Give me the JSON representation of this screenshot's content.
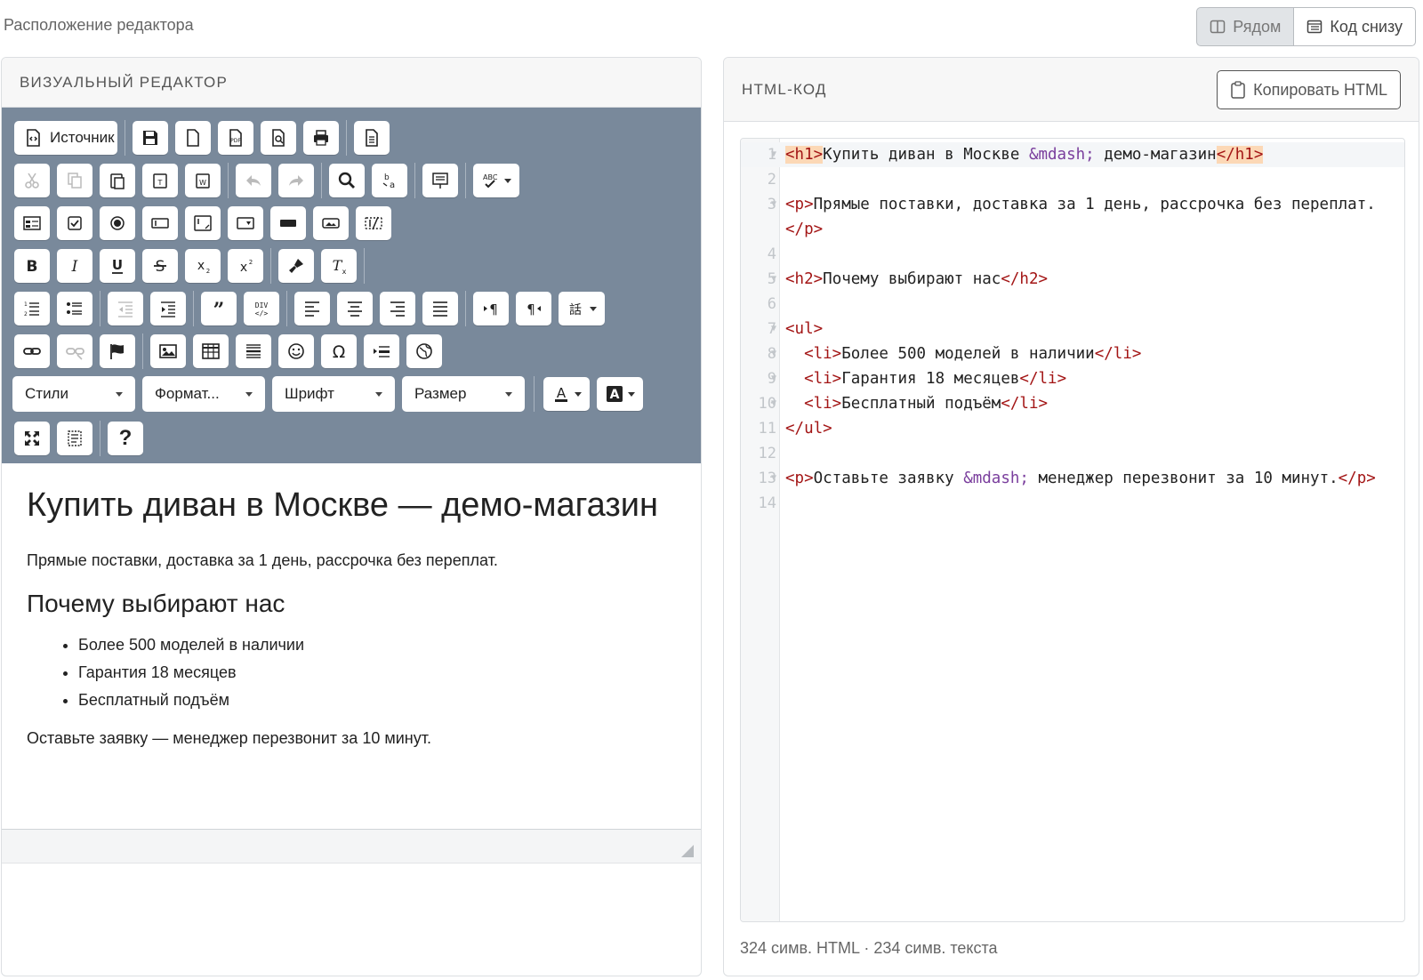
{
  "layout": {
    "label": "Расположение редактора",
    "side_label": "Рядом",
    "bottom_label": "Код снизу"
  },
  "visual": {
    "title": "ВИЗУАЛЬНЫЙ РЕДАКТОР",
    "source_label": "Источник",
    "combos": [
      "Стили",
      "Формат...",
      "Шрифт",
      "Размер"
    ],
    "help_label": "?",
    "content": {
      "h1": "Купить диван в Москве — демо-магазин",
      "p1": "Прямые поставки, доставка за 1 день, рассрочка без переплат.",
      "h2": "Почему выбирают нас",
      "items": [
        "Более 500 моделей в наличии",
        "Гарантия 18 месяцев",
        "Бесплатный подъём"
      ],
      "p2": "Оставьте заявку — менеджер перезвонит за 10 минут."
    }
  },
  "code": {
    "title": "HTML-КОД",
    "copy_label": "Копировать HTML",
    "line_numbers": [
      "1",
      "2",
      "3",
      "4",
      "5",
      "6",
      "7",
      "8",
      "9",
      "10",
      "11",
      "12",
      "13",
      "14"
    ],
    "lines": {
      "l1_open": "<h1>",
      "l1_text": "Купить диван в Москве ",
      "l1_ent": "&mdash;",
      "l1_text2": " демо-магазин",
      "l1_close": "</h1>",
      "l3_open": "<p>",
      "l3_text": "Прямые поставки, доставка за 1 день, рассрочка без переплат.",
      "l3_close": "</p>",
      "l5_open": "<h2>",
      "l5_text": "Почему выбирают нас",
      "l5_close": "</h2>",
      "l7": "<ul>",
      "li_open": "<li>",
      "li_close": "</li>",
      "l8_text": "Более 500 моделей в наличии",
      "l9_text": "Гарантия 18 месяцев",
      "l10_text": "Бесплатный подъём",
      "l11": "</ul>",
      "l13_open": "<p>",
      "l13_text": "Оставьте заявку ",
      "l13_ent": "&mdash;",
      "l13_text2": " менеджер перезвонит за 10 минут.",
      "l13_close": "</p>"
    },
    "counter": "324 симв. HTML · 234 симв. текста"
  }
}
